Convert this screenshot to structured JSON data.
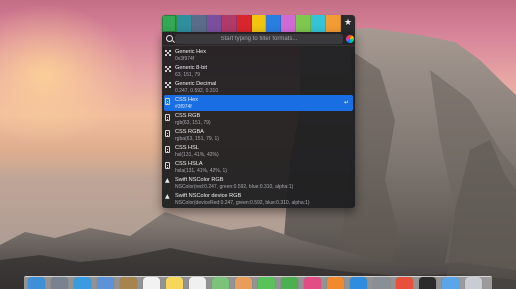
{
  "swatches": [
    {
      "name": "green",
      "color": "#34a853"
    },
    {
      "name": "teal",
      "color": "#2f8f9d"
    },
    {
      "name": "slate",
      "color": "#5c6b8a"
    },
    {
      "name": "purple",
      "color": "#7a4fa0"
    },
    {
      "name": "magenta",
      "color": "#b03a6a"
    },
    {
      "name": "red",
      "color": "#d9262e"
    },
    {
      "name": "yellow",
      "color": "#f1c40f"
    },
    {
      "name": "blue",
      "color": "#2a7de1"
    },
    {
      "name": "pink",
      "color": "#d06bd6"
    },
    {
      "name": "lime",
      "color": "#7ec850"
    },
    {
      "name": "cyan",
      "color": "#35c3d8"
    },
    {
      "name": "orange",
      "color": "#f39c33"
    }
  ],
  "favorite_icon": "star-icon",
  "search": {
    "placeholder": "Start typing to filter formats..."
  },
  "formats": [
    {
      "name": "Generic Hex",
      "value": "0x3f974f",
      "icon": "grid-icon"
    },
    {
      "name": "Generic 8-bit",
      "value": "63, 151, 79",
      "icon": "grid-icon"
    },
    {
      "name": "Generic Decimal",
      "value": "0.247, 0.592, 0.310",
      "icon": "grid-icon"
    },
    {
      "name": "CSS Hex",
      "value": "#3f974f",
      "icon": "css-icon",
      "selected": true
    },
    {
      "name": "CSS RGB",
      "value": "rgb(63, 151, 79)",
      "icon": "css-icon"
    },
    {
      "name": "CSS RGBA",
      "value": "rgba(63, 151, 79, 1)",
      "icon": "css-icon"
    },
    {
      "name": "CSS HSL",
      "value": "hsl(131, 41%, 42%)",
      "icon": "css-icon"
    },
    {
      "name": "CSS HSLA",
      "value": "hsla(131, 41%, 42%, 1)",
      "icon": "css-icon"
    },
    {
      "name": "Swift NSColor RGB",
      "value": "NSColor(red:0.247, green:0.592, blue:0.310, alpha:1)",
      "icon": "swift-icon"
    },
    {
      "name": "Swift NSColor device RGB",
      "value": "NSColor(deviceRed:0.247, green:0.592, blue:0.310, alpha:1)",
      "icon": "swift-icon"
    }
  ],
  "dock_apps": [
    {
      "name": "finder",
      "color": "#3f8fd8"
    },
    {
      "name": "launchpad",
      "color": "#7a8290"
    },
    {
      "name": "safari",
      "color": "#3b9be0"
    },
    {
      "name": "mail",
      "color": "#5b92d8"
    },
    {
      "name": "contacts",
      "color": "#a6844e"
    },
    {
      "name": "calendar",
      "color": "#f2f2f2"
    },
    {
      "name": "notes",
      "color": "#f5d75a"
    },
    {
      "name": "reminders",
      "color": "#f0f0f0"
    },
    {
      "name": "maps",
      "color": "#7bc27a"
    },
    {
      "name": "photos",
      "color": "#e89e5a"
    },
    {
      "name": "messages",
      "color": "#58c35a"
    },
    {
      "name": "facetime",
      "color": "#4caf50"
    },
    {
      "name": "itunes",
      "color": "#e24d86"
    },
    {
      "name": "ibooks",
      "color": "#f08a2c"
    },
    {
      "name": "app-store",
      "color": "#2f8de0"
    },
    {
      "name": "system-preferences",
      "color": "#8a8f96"
    },
    {
      "name": "color-picker",
      "color": "#e8503c"
    },
    {
      "name": "terminal",
      "color": "#2b2b2b"
    },
    {
      "name": "folder",
      "color": "#5aa6e8"
    },
    {
      "name": "trash",
      "color": "#c9ccd2"
    }
  ]
}
